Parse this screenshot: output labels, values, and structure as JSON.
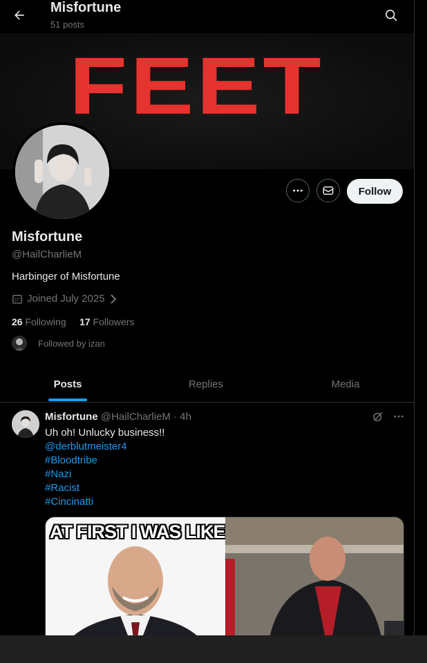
{
  "header": {
    "title": "Misfortune",
    "post_count": "51 posts"
  },
  "banner": {
    "text": "FEET"
  },
  "actions": {
    "follow_label": "Follow"
  },
  "profile": {
    "name": "Misfortune",
    "handle": "@HailCharlieM",
    "bio": "Harbinger of Misfortune",
    "joined": "Joined July 2025",
    "following_count": "26",
    "following_label": "Following",
    "followers_count": "17",
    "followers_label": "Followers",
    "followed_by": "Followed by izan"
  },
  "tabs": [
    {
      "label": "Posts",
      "active": true
    },
    {
      "label": "Replies",
      "active": false
    },
    {
      "label": "Media",
      "active": false
    }
  ],
  "post": {
    "author": "Misfortune",
    "handle": "@HailCharlieM",
    "time": "· 4h",
    "text": "Uh oh! Unlucky business!!",
    "tags": [
      "@derblutmeister4",
      "#Bloodtribe",
      "#Nazi",
      "#Racist",
      "#Cincinatti"
    ],
    "meme_caption": "AT FIRST I WAS LIKE"
  },
  "colors": {
    "accent": "#1d9bf0",
    "banner_text": "#e5332f",
    "background": "#000000",
    "muted": "#71767b"
  }
}
